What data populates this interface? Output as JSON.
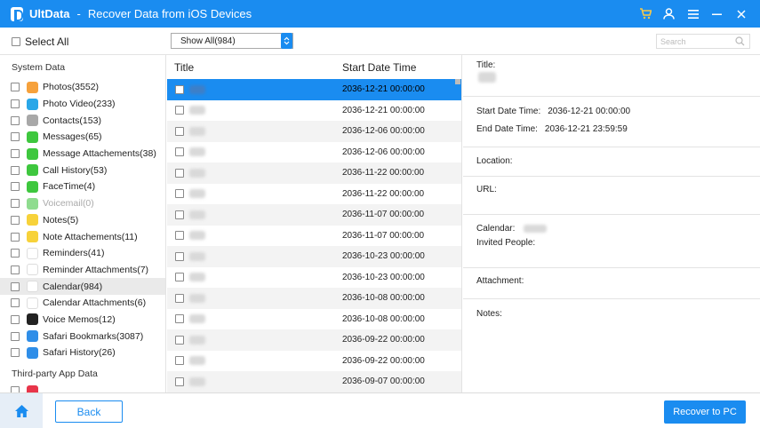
{
  "app": {
    "name": "UltData",
    "separator": "-",
    "subtitle": "Recover Data from iOS Devices"
  },
  "titlebar_icons": [
    "cart-icon",
    "user-icon",
    "menu-icon",
    "minimize-icon",
    "close-icon"
  ],
  "toolbar": {
    "select_all": "Select All",
    "filter_value": "Show All(984)",
    "search_placeholder": "Search"
  },
  "sidebar": {
    "system_title": "System Data",
    "items": [
      {
        "label": "Photos(3552)",
        "icon": "photos-icon",
        "color": "#f6a13b"
      },
      {
        "label": "Photo Video(233)",
        "icon": "photo-video-icon",
        "color": "#2aa7e8"
      },
      {
        "label": "Contacts(153)",
        "icon": "contacts-icon",
        "color": "#a8a8a8"
      },
      {
        "label": "Messages(65)",
        "icon": "messages-icon",
        "color": "#3ec73e"
      },
      {
        "label": "Message Attachements(38)",
        "icon": "message-attachments-icon",
        "color": "#3ec73e"
      },
      {
        "label": "Call History(53)",
        "icon": "call-history-icon",
        "color": "#3ec73e"
      },
      {
        "label": "FaceTime(4)",
        "icon": "facetime-icon",
        "color": "#3ec73e"
      },
      {
        "label": "Voicemail(0)",
        "icon": "voicemail-icon",
        "color": "#8fdc8f",
        "disabled": true
      },
      {
        "label": "Notes(5)",
        "icon": "notes-icon",
        "color": "#f7d23a"
      },
      {
        "label": "Note Attachements(11)",
        "icon": "note-attachments-icon",
        "color": "#f7d23a"
      },
      {
        "label": "Reminders(41)",
        "icon": "reminders-icon",
        "color": "#ffffff"
      },
      {
        "label": "Reminder Attachments(7)",
        "icon": "reminder-attachments-icon",
        "color": "#ffffff"
      },
      {
        "label": "Calendar(984)",
        "icon": "calendar-icon",
        "color": "#ffffff",
        "selected": true
      },
      {
        "label": "Calendar Attachments(6)",
        "icon": "calendar-attachments-icon",
        "color": "#ffffff"
      },
      {
        "label": "Voice Memos(12)",
        "icon": "voice-memos-icon",
        "color": "#222222"
      },
      {
        "label": "Safari Bookmarks(3087)",
        "icon": "safari-bookmarks-icon",
        "color": "#2f8ee8"
      },
      {
        "label": "Safari History(26)",
        "icon": "safari-history-icon",
        "color": "#2f8ee8"
      }
    ],
    "third_party_title": "Third-party App Data"
  },
  "list": {
    "col_title": "Title",
    "col_date": "Start Date Time",
    "rows": [
      {
        "date": "2036-12-21 00:00:00",
        "selected": true
      },
      {
        "date": "2036-12-21 00:00:00"
      },
      {
        "date": "2036-12-06 00:00:00"
      },
      {
        "date": "2036-12-06 00:00:00"
      },
      {
        "date": "2036-11-22 00:00:00"
      },
      {
        "date": "2036-11-22 00:00:00"
      },
      {
        "date": "2036-11-07 00:00:00"
      },
      {
        "date": "2036-11-07 00:00:00"
      },
      {
        "date": "2036-10-23 00:00:00"
      },
      {
        "date": "2036-10-23 00:00:00"
      },
      {
        "date": "2036-10-08 00:00:00"
      },
      {
        "date": "2036-10-08 00:00:00"
      },
      {
        "date": "2036-09-22 00:00:00"
      },
      {
        "date": "2036-09-22 00:00:00"
      },
      {
        "date": "2036-09-07 00:00:00"
      }
    ]
  },
  "details": {
    "title_label": "Title:",
    "start_label": "Start Date Time:",
    "start_value": "2036-12-21 00:00:00",
    "end_label": "End Date Time:",
    "end_value": "2036-12-21 23:59:59",
    "location_label": "Location:",
    "url_label": "URL:",
    "calendar_label": "Calendar:",
    "invited_label": "Invited People:",
    "attachment_label": "Attachment:",
    "notes_label": "Notes:"
  },
  "bottom": {
    "back": "Back",
    "recover": "Recover to PC"
  },
  "colors": {
    "accent": "#1a8cf0",
    "selected_row": "#1a8cf0",
    "sidebar_selected": "#eaeaea"
  }
}
